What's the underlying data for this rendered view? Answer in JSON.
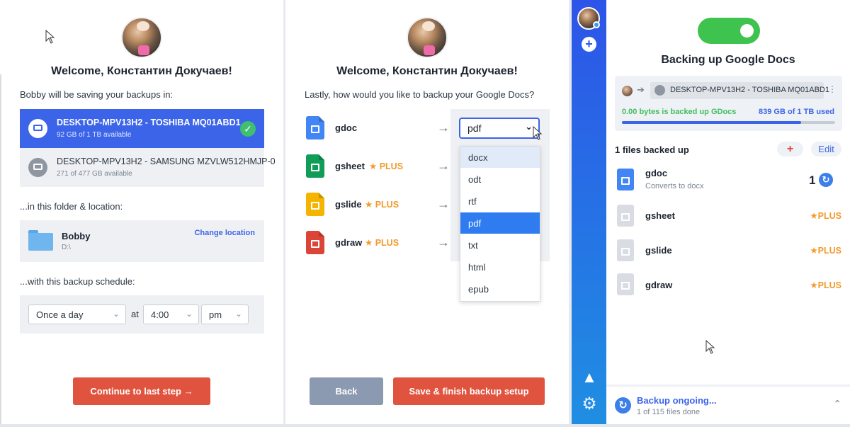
{
  "user": {
    "welcome": "Welcome, Константин Докучаев!"
  },
  "step1": {
    "saving_label": "Bobby will be saving your backups in:",
    "drives": [
      {
        "name": "DESKTOP-MPV13H2 - TOSHIBA MQ01ABD1",
        "sub": "92 GB of 1 TB available",
        "selected": true
      },
      {
        "name": "DESKTOP-MPV13H2 - SAMSUNG MZVLW512HMJP-0",
        "sub": "271 of 477 GB available",
        "selected": false
      }
    ],
    "folder_label": "...in this folder & location:",
    "folder": {
      "name": "Bobby",
      "path": "D:\\",
      "change_label": "Change location"
    },
    "schedule_label": "...with this backup schedule:",
    "schedule": {
      "frequency": "Once a day",
      "at": "at",
      "time": "4:00",
      "ampm": "pm"
    },
    "continue_label": "Continue to last step →"
  },
  "step2": {
    "question": "Lastly, how would you like to backup your Google Docs?",
    "types": [
      {
        "name": "gdoc",
        "plus": ""
      },
      {
        "name": "gsheet",
        "plus": "PLUS"
      },
      {
        "name": "gslide",
        "plus": "PLUS"
      },
      {
        "name": "gdraw",
        "plus": "PLUS"
      }
    ],
    "arrow": "→",
    "selected_format": "pdf",
    "format_options": [
      "docx",
      "odt",
      "rtf",
      "pdf",
      "txt",
      "html",
      "epub"
    ],
    "back_label": "Back",
    "finish_label": "Save & finish backup setup"
  },
  "status": {
    "title": "Backing up Google Docs",
    "device": "DESKTOP-MPV13H2 - TOSHIBA MQ01ABD1",
    "backed_text": "0.00 bytes is backed up GDocs",
    "used_text": "839 GB of 1 TB used",
    "used_fraction": 0.84,
    "files_header": "1 files backed up",
    "edit_label": "Edit",
    "plus_symbol": "+",
    "files": [
      {
        "name": "gdoc",
        "sub": "Converts to docx",
        "count": "1",
        "plus": ""
      },
      {
        "name": "gsheet",
        "sub": "",
        "count": "",
        "plus": "PLUS"
      },
      {
        "name": "gslide",
        "sub": "",
        "count": "",
        "plus": "PLUS"
      },
      {
        "name": "gdraw",
        "sub": "",
        "count": "",
        "plus": "PLUS"
      }
    ],
    "footer_title": "Backup ongoing...",
    "footer_sub": "1 of 115 files done"
  },
  "colors": {
    "primary": "#3c64e9",
    "cta": "#e0533e",
    "success": "#3fc34f",
    "plus_orange": "#f39a2b",
    "gdoc_blue": "#4285f4",
    "gsheet_green": "#0f9d58",
    "gslide_yellow": "#f4b400",
    "gdraw_red": "#db4437"
  },
  "icons": [
    "monitor-icon",
    "check-icon",
    "folder-icon",
    "chevron-down-icon",
    "star-icon",
    "arrow-right-icon",
    "sync-icon",
    "warning-icon",
    "gear-icon",
    "plus-icon",
    "more-icon",
    "chevron-up-icon"
  ]
}
